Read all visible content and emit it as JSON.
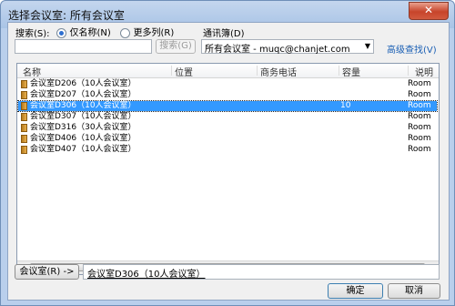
{
  "window": {
    "title": "选择会议室: 所有会议室",
    "close_glyph": "✕"
  },
  "search": {
    "label": "搜索(S):",
    "radio_name_only": "仅名称(N)",
    "radio_more_columns": "更多列(R)",
    "input_value": "",
    "button": "搜索(G)"
  },
  "address_book": {
    "label": "通讯簿(D)",
    "selected": "所有会议室 - muqc@chanjet.com",
    "advanced_find": "高级查找(V)"
  },
  "columns": [
    "名称",
    "位置",
    "商务电话",
    "容量",
    "说明"
  ],
  "rooms": [
    {
      "name": "会议室D206（10人会议室）",
      "capacity": "",
      "desc": "Room"
    },
    {
      "name": "会议室D207（10人会议室）",
      "capacity": "",
      "desc": "Room"
    },
    {
      "name": "会议室D306（10人会议室）",
      "capacity": "10",
      "desc": "Room",
      "selected": true
    },
    {
      "name": "会议室D307（10人会议室）",
      "capacity": "",
      "desc": "Room"
    },
    {
      "name": "会议室D316（30人会议室）",
      "capacity": "",
      "desc": "Room"
    },
    {
      "name": "会议室D406（10人会议室）",
      "capacity": "",
      "desc": "Room"
    },
    {
      "name": "会议室D407（10人会议室）",
      "capacity": "",
      "desc": "Room"
    }
  ],
  "picker": {
    "button": "会议室(R) ->",
    "value": "会议室D306（10人会议室）"
  },
  "buttons": {
    "ok": "确定",
    "cancel": "取消"
  },
  "icons": {
    "room": "room-book-icon",
    "dropdown": "▼",
    "scroll_left": "◀",
    "scroll_right": "▶"
  },
  "colors": {
    "selection": "#3399ff",
    "link": "#1a5fb4"
  }
}
